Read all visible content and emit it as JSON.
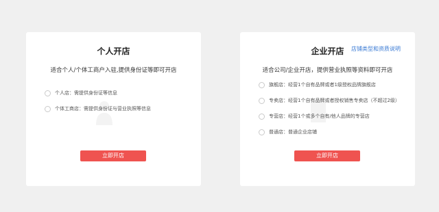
{
  "personal": {
    "title": "个人开店",
    "description": "适合个人/个体工商户入驻,提供身份证等即可开店",
    "options": [
      {
        "label": "个人店：需提供身份证等信息"
      },
      {
        "label": "个体工商店：需提供身份证与营业执照等信息"
      }
    ],
    "button_label": "立即开店"
  },
  "company": {
    "title": "企业开店",
    "help_link": "店铺类型和资质说明",
    "description": "适合公司/企业开店，提供营业执照等资料即可开店",
    "options": [
      {
        "label": "旗舰店：经营1个自有品牌或者1级授权品牌旗舰店"
      },
      {
        "label": "专卖店：经营1个自有品牌或者授权销售专卖店（不超过2级）"
      },
      {
        "label": "专营店：经营1个或多个自有/他人品牌的专营店"
      },
      {
        "label": "普通店：普通企业店铺"
      }
    ],
    "button_label": "立即开店"
  },
  "colors": {
    "page_background": "#f0f0f0",
    "card_background": "#ffffff",
    "button": "#ef5350",
    "link": "#3b7bd4"
  },
  "icons": {
    "personal_watermark": "person-icon",
    "company_watermark": "building-icon"
  }
}
